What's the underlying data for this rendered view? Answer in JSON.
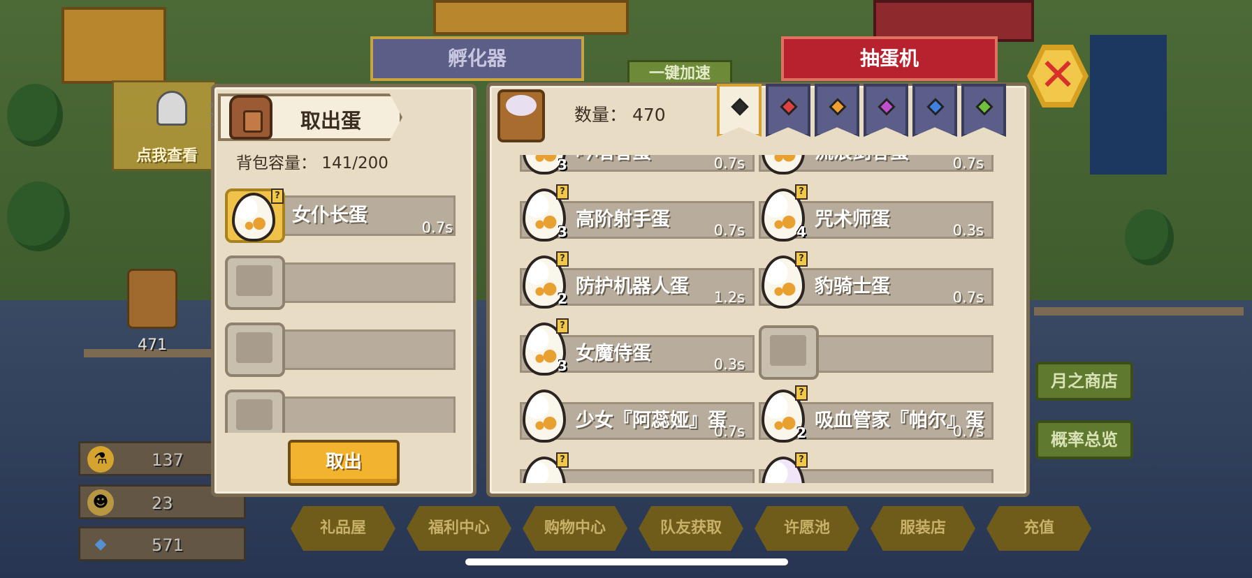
{
  "background": {
    "notice_text": "点我查看",
    "basket_count": "471",
    "currencies": [
      {
        "icon": "potion-icon",
        "value": "137"
      },
      {
        "icon": "character-token-icon",
        "value": "23"
      },
      {
        "icon": "diamond-icon",
        "value": "571"
      }
    ],
    "shop_tabs": [
      "礼品屋",
      "福利中心",
      "购物中心",
      "队友获取",
      "许愿池",
      "服装店",
      "充值"
    ],
    "side_buttons": [
      "月之商店",
      "概率总览"
    ],
    "hatcher_title": "孵化器",
    "gacha_title": "抽蛋机",
    "speed_button": "一键加速"
  },
  "left_panel": {
    "title": "取出蛋",
    "capacity_label": "背包容量：",
    "capacity_value": "141/200",
    "slots": [
      {
        "name": "女仆长蛋",
        "time": "0.7s",
        "filled": true
      },
      {
        "name": "",
        "time": "",
        "filled": false
      },
      {
        "name": "",
        "time": "",
        "filled": false
      },
      {
        "name": "",
        "time": "",
        "filled": false
      }
    ],
    "take_out_button": "取出"
  },
  "right_panel": {
    "quantity_label": "数量：",
    "quantity_value": "470",
    "filter_tabs": [
      {
        "color": "#2b2b2b",
        "active": true
      },
      {
        "color": "#e04040",
        "active": false
      },
      {
        "color": "#f0a030",
        "active": false
      },
      {
        "color": "#c050d0",
        "active": false
      },
      {
        "color": "#4080e0",
        "active": false
      },
      {
        "color": "#70c040",
        "active": false
      }
    ],
    "eggs": [
      {
        "name": "吟唱者蛋",
        "time": "0.7s",
        "count": "3"
      },
      {
        "name": "流浪剑客蛋",
        "time": "0.7s",
        "count": ""
      },
      {
        "name": "高阶射手蛋",
        "time": "0.7s",
        "count": "3"
      },
      {
        "name": "咒术师蛋",
        "time": "0.3s",
        "count": "4"
      },
      {
        "name": "防护机器人蛋",
        "time": "1.2s",
        "count": "2"
      },
      {
        "name": "豹骑士蛋",
        "time": "0.7s",
        "count": ""
      },
      {
        "name": "女魔侍蛋",
        "time": "0.3s",
        "count": "3"
      },
      {
        "name": "",
        "time": "",
        "count": ""
      },
      {
        "name": "少女『阿蕊娅』蛋",
        "time": "0.7s",
        "count": ""
      },
      {
        "name": "吸血管家『帕尔』蛋",
        "time": "0.7s",
        "count": "2"
      }
    ]
  }
}
